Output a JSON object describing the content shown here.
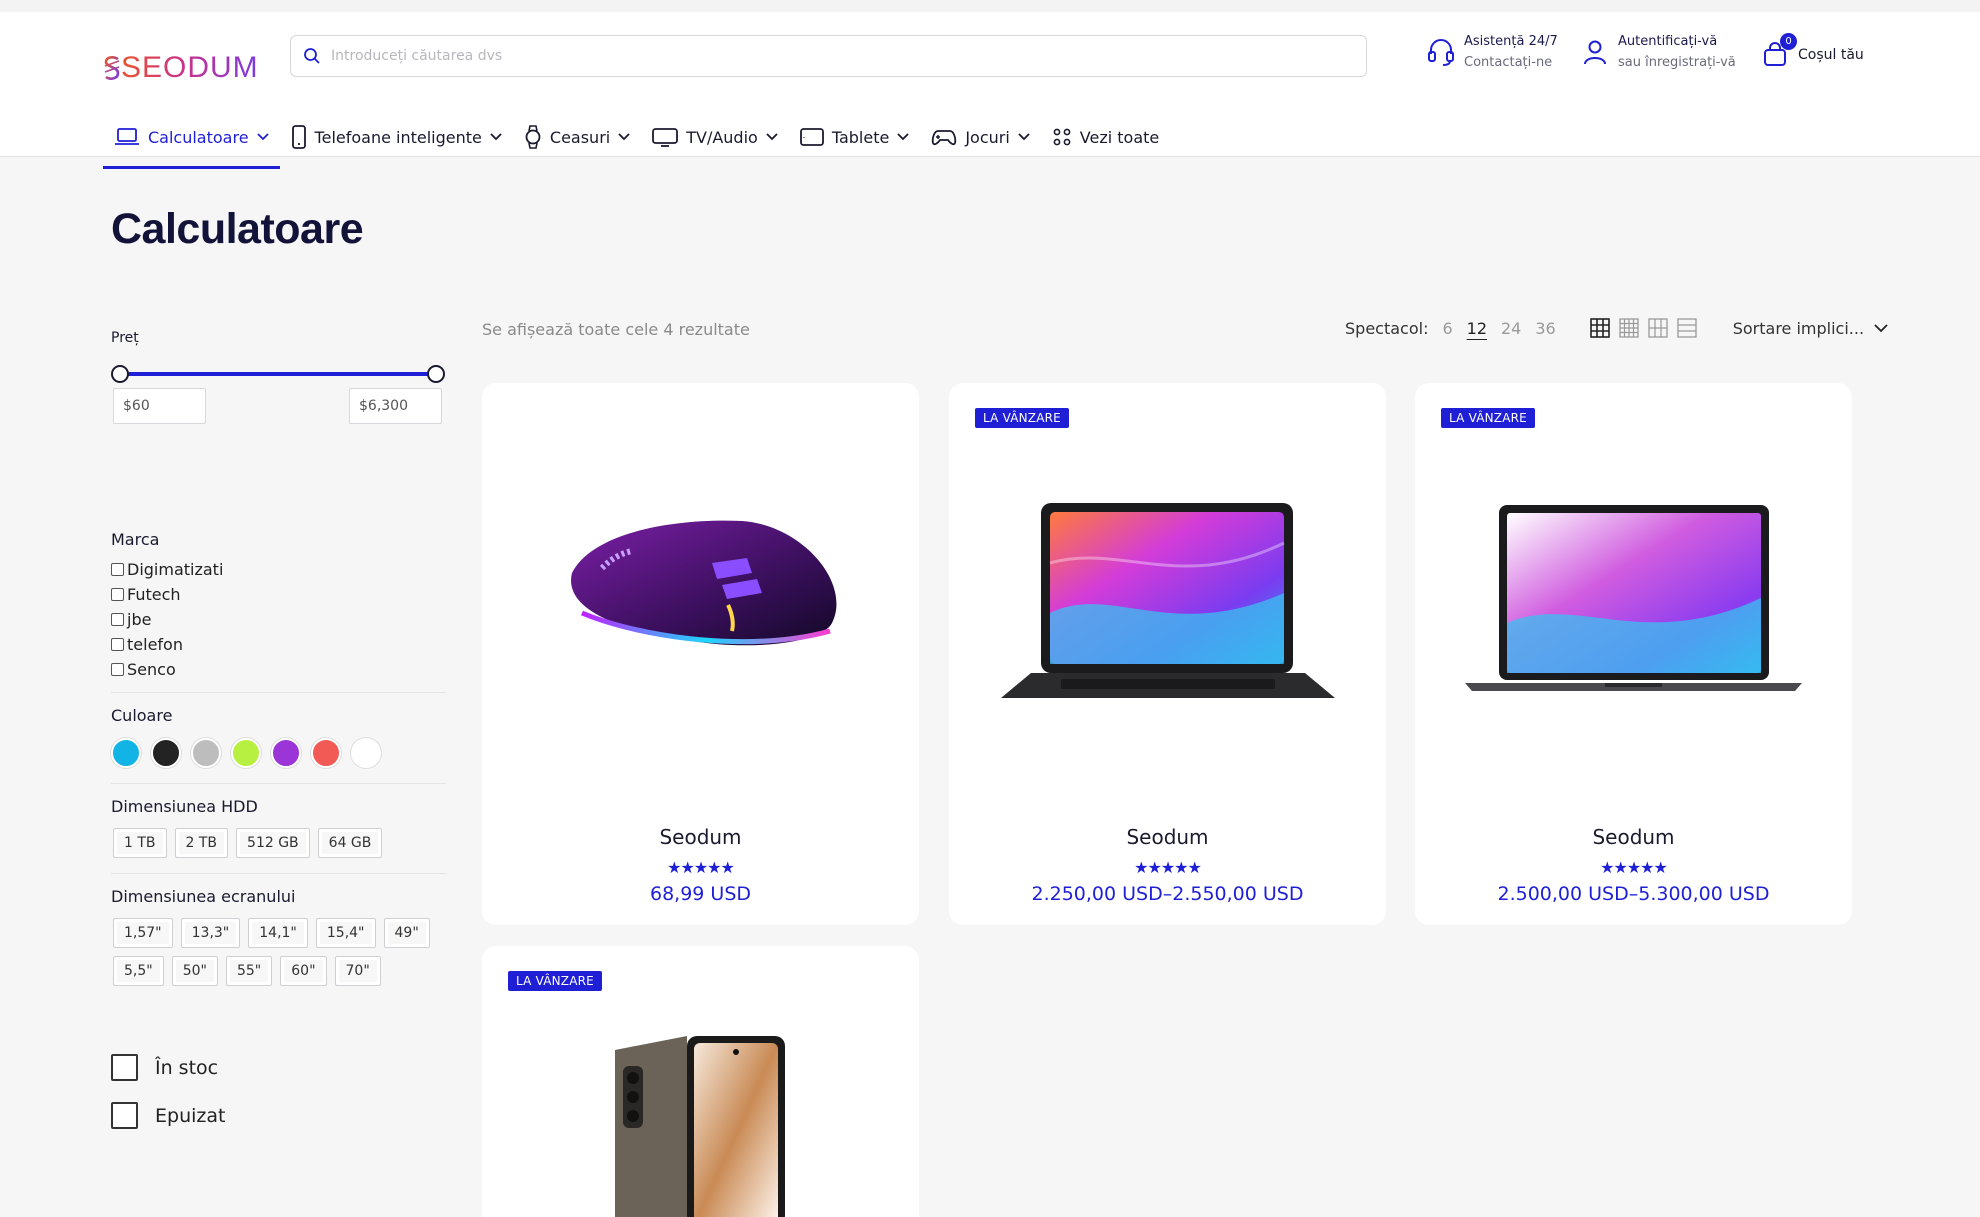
{
  "header": {
    "logo": "SEODUM",
    "search_placeholder": "Introduceți căutarea dvs",
    "support_title": "Asistență 24/7",
    "support_sub": "Contactați-ne",
    "login_title": "Autentificați-vă",
    "login_sub": "sau înregistrați-vă",
    "cart_count": "0",
    "cart_label": "Coșul tău"
  },
  "nav": [
    {
      "label": "Calculatoare",
      "icon": "laptop-icon"
    },
    {
      "label": "Telefoane inteligente",
      "icon": "phone-icon"
    },
    {
      "label": "Ceasuri",
      "icon": "watch-icon"
    },
    {
      "label": "TV/Audio",
      "icon": "tv-icon"
    },
    {
      "label": "Tablete",
      "icon": "tablet-icon"
    },
    {
      "label": "Jocuri",
      "icon": "gamepad-icon"
    },
    {
      "label": "Vezi toate",
      "icon": "grid-dots-icon"
    }
  ],
  "page_title": "Calculatoare",
  "filters": {
    "price_label": "Preț",
    "price_min": "$60",
    "price_max": "$6,300",
    "brand_label": "Marca",
    "brands": [
      "Digimatizati",
      "Futech",
      "jbe",
      "telefon",
      "Senco"
    ],
    "color_label": "Culoare",
    "colors": [
      "#12b4e6",
      "#232323",
      "#bdbdbd",
      "#b7f041",
      "#9b35d8",
      "#f25b55",
      "#ffffff"
    ],
    "hdd_label": "Dimensiunea HDD",
    "hdd": [
      "1 TB",
      "2 TB",
      "512 GB",
      "64 GB"
    ],
    "screen_label": "Dimensiunea ecranului",
    "screen_row1": [
      "1,57\"",
      "13,3\"",
      "14,1\"",
      "15,4\"",
      "49\""
    ],
    "screen_row2": [
      "5,5\"",
      "50\"",
      "55\"",
      "60\"",
      "70\""
    ],
    "in_stock": "În stoc",
    "sold_out": "Epuizat"
  },
  "results_text": "Se afișează toate cele 4 rezultate",
  "toolbar": {
    "show_label": "Spectacol:",
    "per_page": [
      "6",
      "12",
      "24",
      "36"
    ],
    "selected_per_page": "12",
    "sort_label": "Sortare implici..."
  },
  "products": [
    {
      "name": "Seodum",
      "price": "68,99 USD",
      "badge": "",
      "stars": "★★★★★"
    },
    {
      "name": "Seodum",
      "price": "2.250,00 USD–2.550,00 USD",
      "badge": "LA VÂNZARE",
      "stars": "★★★★★"
    },
    {
      "name": "Seodum",
      "price": "2.500,00 USD–5.300,00 USD",
      "badge": "LA VÂNZARE",
      "stars": "★★★★★"
    },
    {
      "name": "",
      "price": "",
      "badge": "LA VÂNZARE",
      "stars": ""
    }
  ],
  "accent": "#1f1fd6"
}
